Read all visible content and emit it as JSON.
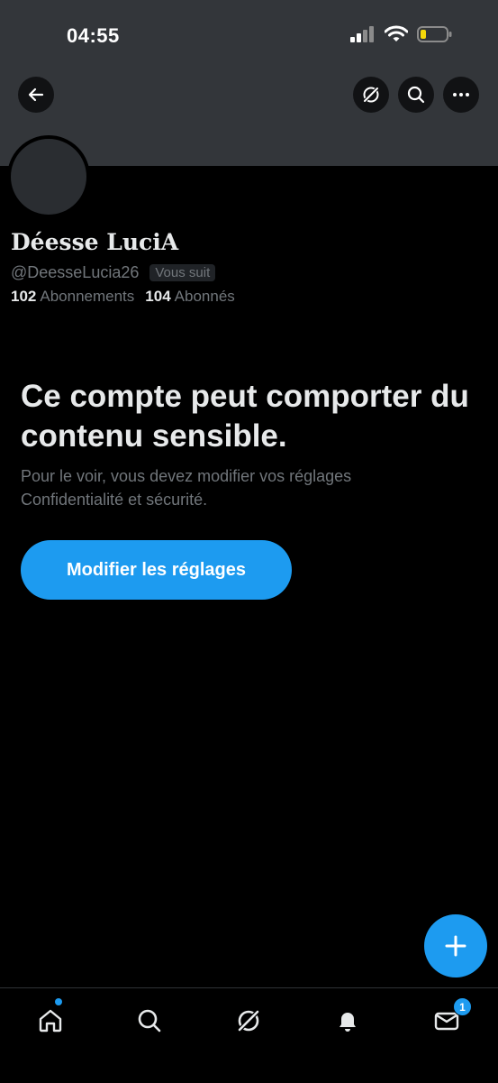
{
  "status_bar": {
    "time": "04:55"
  },
  "profile": {
    "display_name": "Déesse LuciA",
    "handle": "@DeesseLucia26",
    "follows_you": "Vous suit",
    "following_count": "102",
    "following_label": "Abonnements",
    "followers_count": "104",
    "followers_label": "Abonnés"
  },
  "sensitive": {
    "title": "Ce compte peut comporter du contenu sensible.",
    "description": "Pour le voir, vous devez modifier vos réglages Confidentialité et sécurité.",
    "button_label": "Modifier les réglages"
  },
  "nav": {
    "items": [
      "home-icon",
      "search-icon",
      "grok-icon",
      "bell-icon",
      "mail-icon"
    ],
    "messages_badge": "1"
  },
  "colors": {
    "accent": "#1d9bf0",
    "banner": "#33363a",
    "background": "#000000"
  }
}
